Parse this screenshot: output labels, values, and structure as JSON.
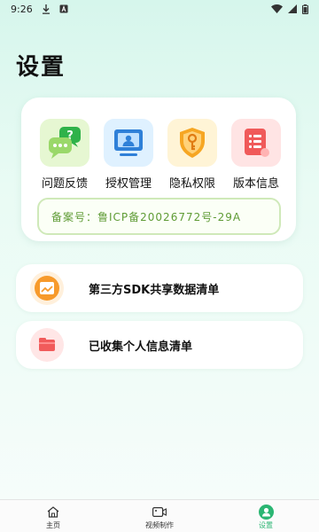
{
  "status_bar": {
    "time": "9:26",
    "icons": [
      "download-icon",
      "a-app-icon",
      "wifi-icon",
      "signal-icon",
      "battery-icon"
    ]
  },
  "page": {
    "title": "设置"
  },
  "tiles": [
    {
      "label": "问题反馈",
      "icon": "chat-question-icon",
      "color": "#e6f7d2"
    },
    {
      "label": "授权管理",
      "icon": "monitor-user-icon",
      "color": "#dff1ff"
    },
    {
      "label": "隐私权限",
      "icon": "shield-key-icon",
      "color": "#fff4d6"
    },
    {
      "label": "版本信息",
      "icon": "document-icon",
      "color": "#ffe4e4"
    }
  ],
  "record": {
    "text": "备案号：鲁ICP备20026772号-29A"
  },
  "list": [
    {
      "label": "第三方SDK共享数据清单",
      "icon": "chart-folder-icon",
      "color": "#fff0dc"
    },
    {
      "label": "已收集个人信息清单",
      "icon": "folder-icon",
      "color": "#ffe6e6"
    }
  ],
  "nav": [
    {
      "label": "主页",
      "icon": "home-icon",
      "active": false
    },
    {
      "label": "视频制作",
      "icon": "video-camera-icon",
      "active": false
    },
    {
      "label": "设置",
      "icon": "user-circle-icon",
      "active": true
    }
  ],
  "colors": {
    "accent": "#2bb673",
    "record_text": "#5f9b35",
    "record_border": "#cfe9b9"
  }
}
